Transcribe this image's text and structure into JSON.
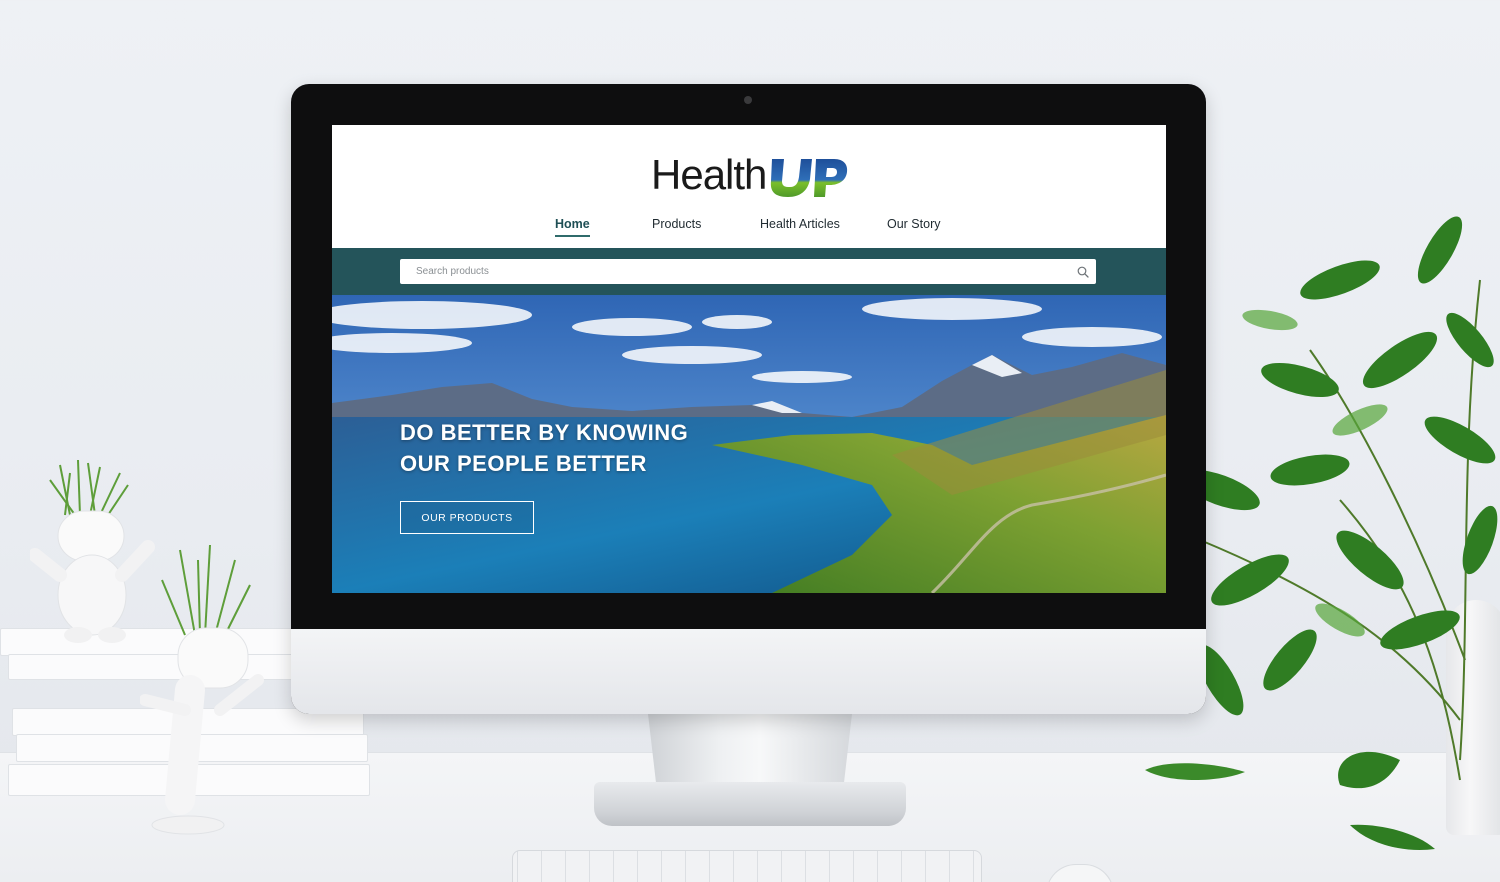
{
  "site": {
    "logo_text": "Health",
    "logo_mark": "UP",
    "colors": {
      "accent": "#24545a",
      "nav_active": "#1f4f55",
      "logo_blue": "#1e4f9a",
      "logo_green": "#7bbf2a"
    }
  },
  "nav": {
    "items": [
      {
        "label": "Home",
        "active": true
      },
      {
        "label": "Products",
        "active": false
      },
      {
        "label": "Health Articles",
        "active": false
      },
      {
        "label": "Our Story",
        "active": false
      }
    ]
  },
  "search": {
    "placeholder": "Search products",
    "value": "",
    "icon": "search-icon"
  },
  "hero": {
    "title_line1": "DO BETTER BY KNOWING",
    "title_line2": "OUR PEOPLE BETTER",
    "button_label": "OUR PRODUCTS"
  }
}
